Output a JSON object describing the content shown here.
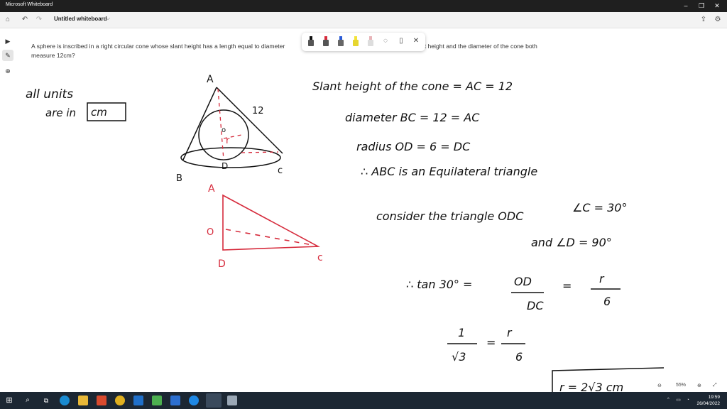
{
  "window": {
    "title": "Microsoft Whiteboard"
  },
  "toolbar": {
    "doc_title": "Untitled whiteboard",
    "doc_chevron": "⌵"
  },
  "question": {
    "text_part1": "A sphere is inscribed in a right circular cone whose slant height has a length equal to diameter",
    "text_part2": "ere if the slant height and the diameter of the cone both",
    "text_line2": "measure 12cm?"
  },
  "ink_text": {
    "units_line1": "all units",
    "units_line2": "are in",
    "units_box": "cm",
    "label_A": "A",
    "label_12": "12",
    "label_O": "o",
    "label_r": "r",
    "label_B": "B",
    "label_D": "D",
    "label_C": "c",
    "red_A": "A",
    "red_O": "O",
    "red_D": "D",
    "red_C": "c",
    "line1": "Slant height of the cone = AC = 12",
    "line2": "diameter BC = 12 = AC",
    "line3": "radius OD = 6 = DC",
    "line4": "∴ ABC is an Equilateral triangle",
    "line5a": "consider the triangle ODC",
    "line5b": "∠C = 30°",
    "line6": "and ∠D = 90°",
    "tan_lhs": "∴ tan 30° =",
    "tan_num": "OD",
    "tan_den": "DC",
    "eq1": "=",
    "r_num": "r",
    "r_den": "6",
    "frac1_num": "1",
    "frac1_den": "√3",
    "eq2": "=",
    "frac2_num": "r",
    "frac2_den": "6",
    "result": "r = 2√3 cm"
  },
  "zoom": {
    "level": "55%"
  },
  "clock": {
    "time": "19:59",
    "date": "26/04/2022"
  },
  "colors": {
    "ink": "#111111",
    "red_ink": "#d62b3c",
    "titlebar": "#1f1f1f",
    "taskbar": "#1c2733"
  }
}
